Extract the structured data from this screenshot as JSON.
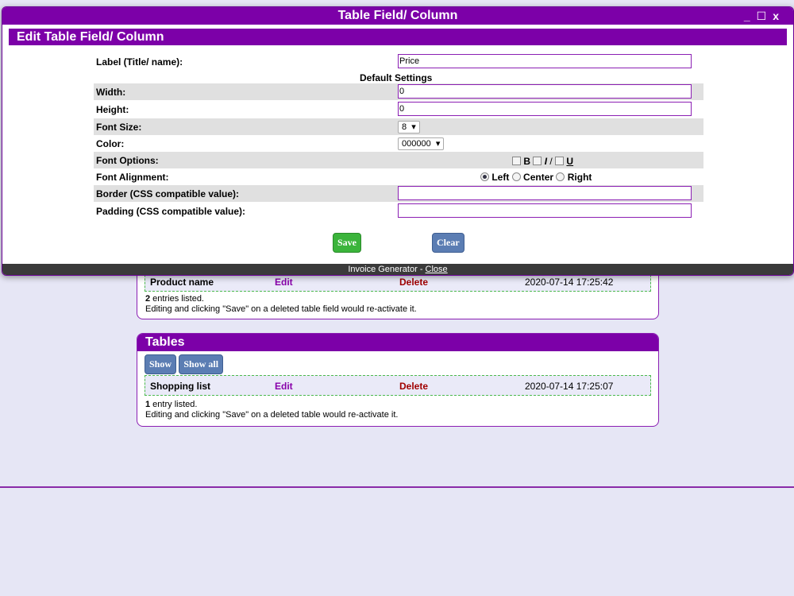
{
  "modal": {
    "title": "Table Field/ Column",
    "controls": {
      "minimize": "_",
      "maximize": "☐",
      "close": "x"
    },
    "header": "Edit Table Field/ Column",
    "label_field": {
      "label": "Label (Title/ name):",
      "value": "Price"
    },
    "default_settings": "Default Settings",
    "width": {
      "label": "Width:",
      "value": "0"
    },
    "height": {
      "label": "Height:",
      "value": "0"
    },
    "font_size": {
      "label": "Font Size:",
      "value": "8"
    },
    "color": {
      "label": "Color:",
      "value": "000000"
    },
    "font_options": {
      "label": "Font Options:",
      "bold": "B",
      "italic": "I",
      "underline": "U",
      "sep": "/"
    },
    "font_alignment": {
      "label": "Font Alignment:",
      "left": "Left",
      "center": "Center",
      "right": "Right",
      "selected": "Left"
    },
    "border": {
      "label": "Border (CSS compatible value):",
      "value": ""
    },
    "padding": {
      "label": "Padding (CSS compatible value):",
      "value": ""
    },
    "save_label": "Save",
    "clear_label": "Clear",
    "footer_text": "Invoice Generator - ",
    "footer_link": "Close"
  },
  "fields_panel": {
    "row": {
      "name": "Product name",
      "edit": "Edit",
      "delete": "Delete",
      "date": "2020-07-14 17:25:42"
    },
    "count": "2",
    "count_suffix": " entries listed.",
    "note": "Editing and clicking \"Save\" on a deleted table field would re-activate it."
  },
  "tables_panel": {
    "title": "Tables",
    "show_label": "Show",
    "show_all_label": "Show all",
    "row": {
      "name": "Shopping list",
      "edit": "Edit",
      "delete": "Delete",
      "date": "2020-07-14 17:25:07"
    },
    "count": "1",
    "count_suffix": " entry listed.",
    "note": "Editing and clicking \"Save\" on a deleted table would re-activate it."
  },
  "colors": {
    "accent": "#7c00a8",
    "save": "#3bb43b",
    "clear": "#5b7db3",
    "page_bg": "#e6e6f5"
  }
}
